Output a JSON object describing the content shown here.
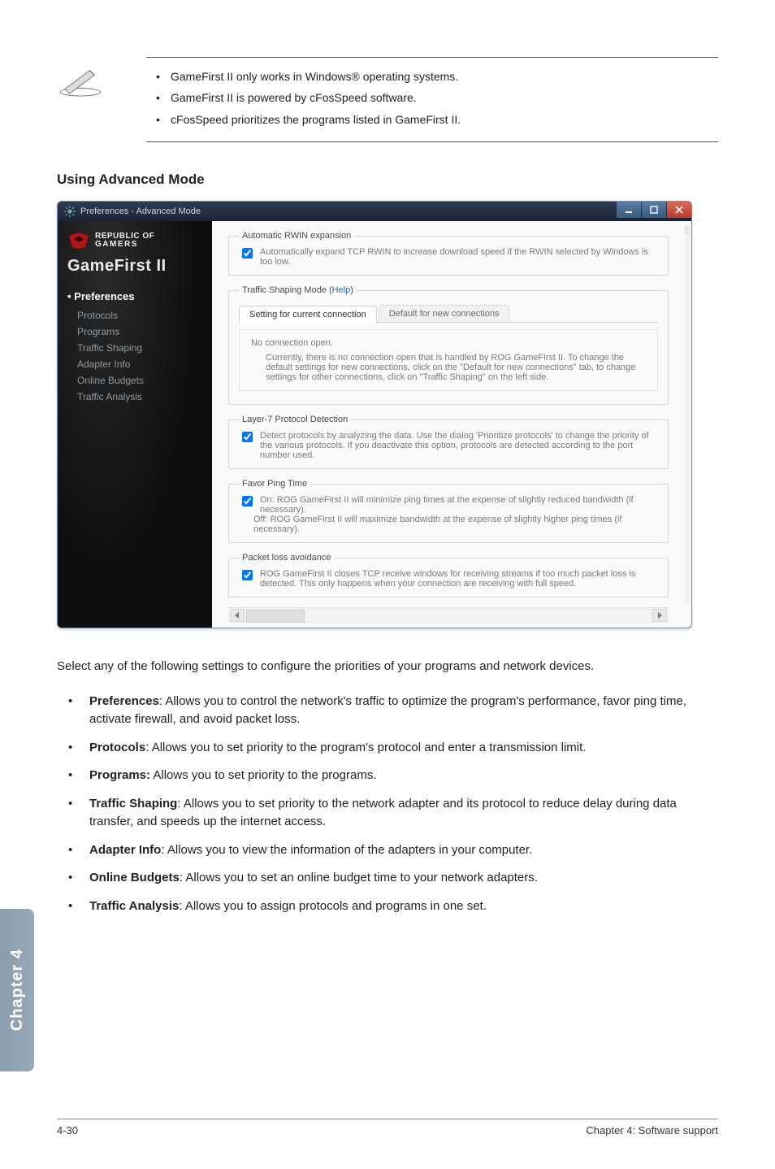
{
  "notes": [
    "GameFirst II only works in Windows® operating systems.",
    "GameFirst II is powered by cFosSpeed software.",
    "cFosSpeed prioritizes the programs listed in GameFirst II."
  ],
  "heading": "Using Advanced Mode",
  "window": {
    "title": "Preferences - Advanced Mode",
    "brand": {
      "line1": "REPUBLIC OF",
      "line2": "GAMERS",
      "product": "GameFirst II"
    },
    "sidebar": {
      "section_title": "Preferences",
      "items": [
        {
          "label": "Protocols"
        },
        {
          "label": "Programs"
        },
        {
          "label": "Traffic Shaping"
        },
        {
          "label": "Adapter Info"
        },
        {
          "label": "Online Budgets"
        },
        {
          "label": "Traffic Analysis"
        }
      ]
    },
    "content": {
      "rwin": {
        "legend": "Automatic RWIN expansion",
        "checkbox_text": "Automatically expand TCP RWIN to increase download speed if the RWIN selected by Windows is too low."
      },
      "mode": {
        "legend_prefix": "Traffic Shaping Mode (",
        "legend_link": "Help",
        "legend_suffix": ")",
        "tabs": {
          "active": "Setting for current connection",
          "inactive": "Default for new connections"
        },
        "noconn_title": "No connection open.",
        "noconn_body": "Currently, there is no connection open that is handled by ROG GameFirst II. To change the default settings for new connections, click on the \"Default for new connections\" tab, to change settings for other connections, click on \"Traffic Shaping\" on the left side."
      },
      "l7": {
        "legend": "Layer-7 Protocol Detection",
        "checkbox_text": "Detect protocols by analyzing the data. Use the dialog 'Prioritize protocols' to change the priority of the various protocols. If you deactivate this option, protocols are detected according to the port number used."
      },
      "ping": {
        "legend": "Favor Ping Time",
        "checkbox_text": "On: ROG GameFirst II will minimize ping times at the expense of slightly reduced bandwidth (if necessary).",
        "off_text": "Off: ROG GameFirst II will maximize bandwidth at the expense of slightly higher ping times (if necessary)."
      },
      "packet": {
        "legend": "Packet loss avoidance",
        "checkbox_text": "ROG GameFirst II closes TCP receive windows for receiving streams if too much packet loss is detected. This only happens when your connection are receiving with full speed."
      }
    }
  },
  "intro": "Select any of the following settings to configure the priorities of your programs and network devices.",
  "bullets": [
    {
      "bold": "Preferences",
      "sep": ": ",
      "text": "Allows you to control the network's traffic to optimize the program's performance, favor ping time, activate firewall, and avoid packet loss."
    },
    {
      "bold": "Protocols",
      "sep": ": ",
      "text": "Allows you to set priority to the program's protocol and enter a transmission limit."
    },
    {
      "bold": "Programs:",
      "sep": " ",
      "text": "Allows you to set priority to the programs."
    },
    {
      "bold": "Traffic Shaping",
      "sep": ": ",
      "text": "Allows you to set priority to the network adapter and its protocol to reduce delay during data transfer, and speeds up the internet access."
    },
    {
      "bold": "Adapter Info",
      "sep": ": ",
      "text": "Allows you to view the information of the adapters in your computer."
    },
    {
      "bold": "Online Budgets",
      "sep": ": ",
      "text": "Allows you to set an online budget time to your network adapters."
    },
    {
      "bold": "Traffic Analysis",
      "sep": ": ",
      "text": "Allows you to assign protocols and programs in one set."
    }
  ],
  "chapter_tab": "Chapter 4",
  "footer": {
    "left": "4-30",
    "right": "Chapter 4: Software support"
  }
}
